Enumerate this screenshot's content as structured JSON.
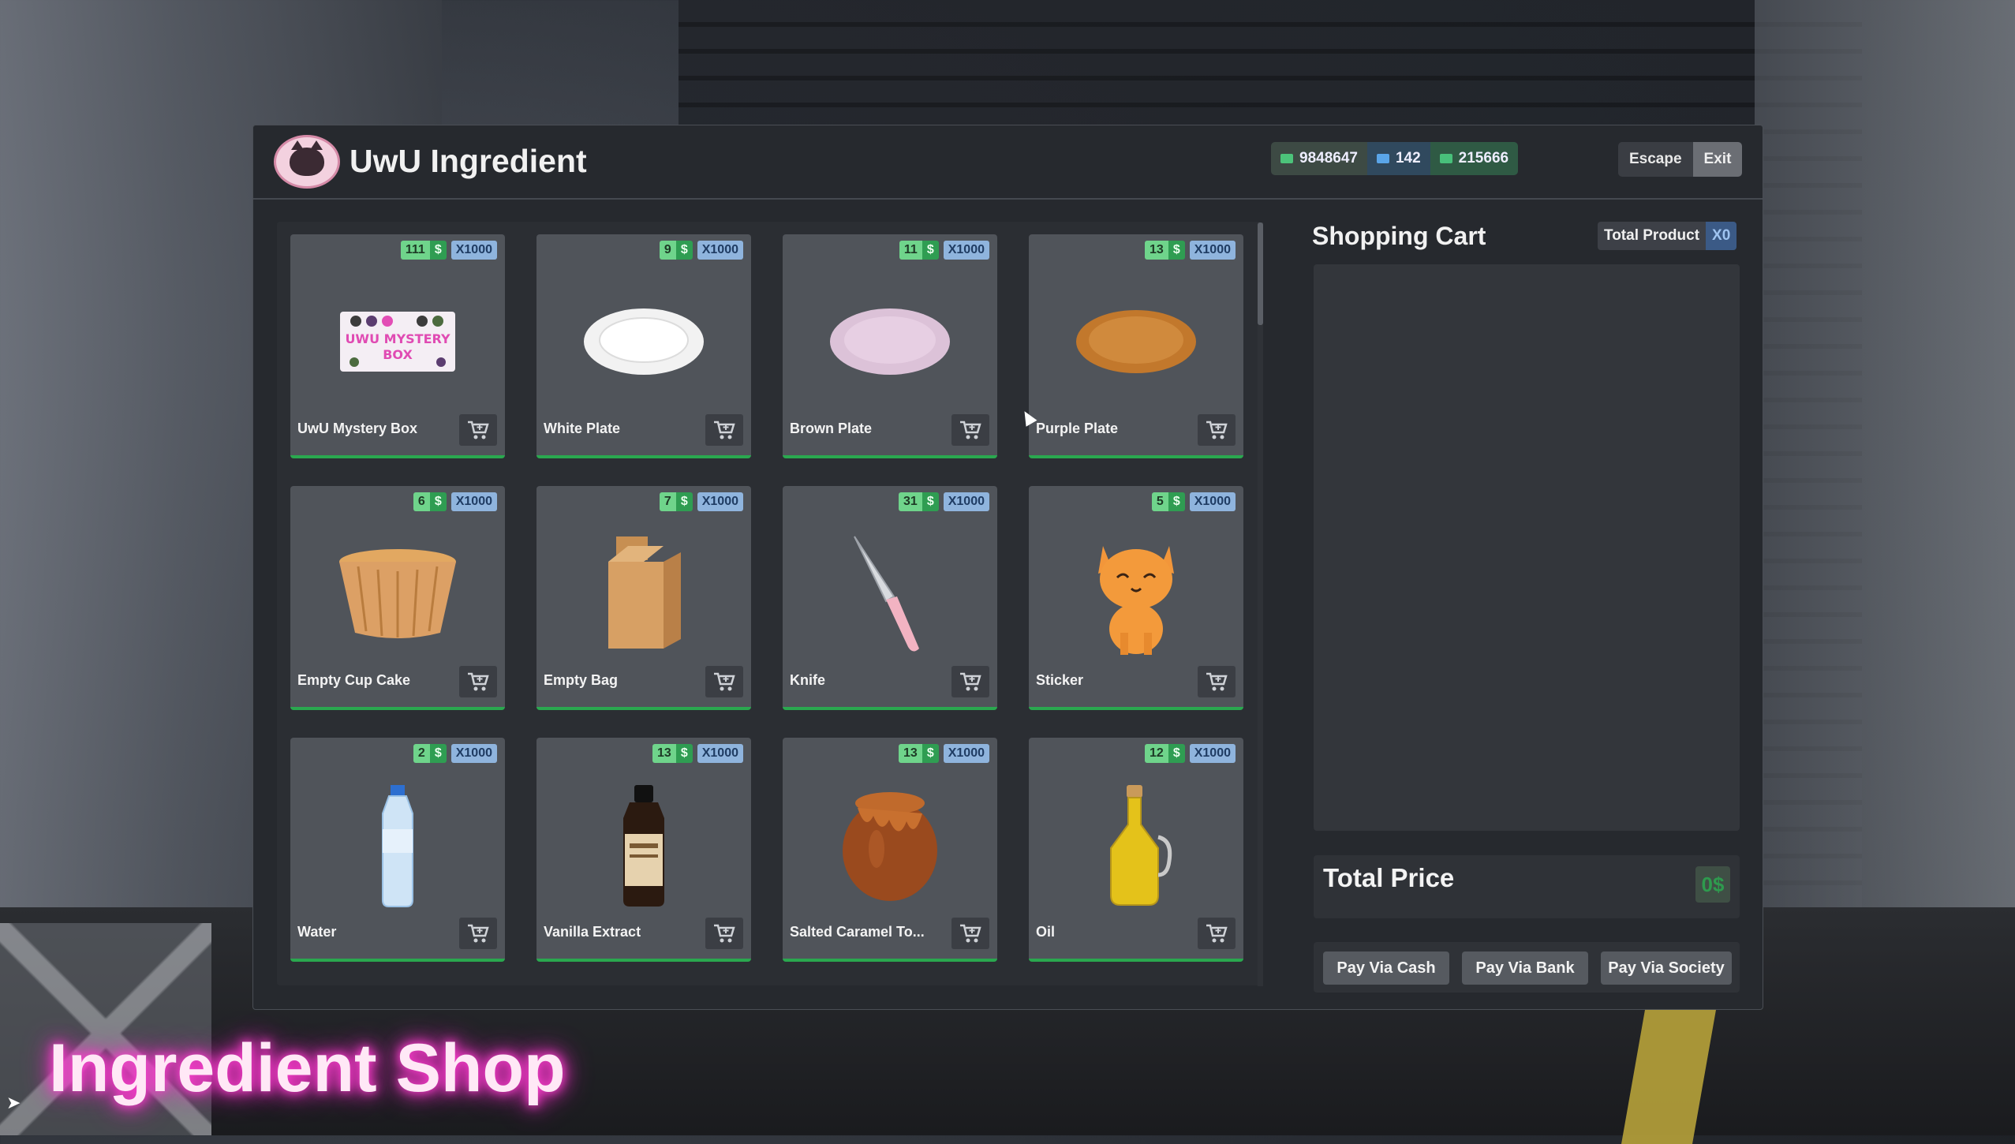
{
  "header": {
    "title": "UwU Ingredient",
    "balances": {
      "cash": "9848647",
      "bank": "142",
      "society": "215666"
    },
    "escape_label": "Escape",
    "exit_label": "Exit"
  },
  "products": [
    {
      "name": "UwU Mystery Box",
      "price": "111",
      "currency": "$",
      "qty": "X1000",
      "icon": "mystery-box-icon"
    },
    {
      "name": "White Plate",
      "price": "9",
      "currency": "$",
      "qty": "X1000",
      "icon": "white-plate-icon"
    },
    {
      "name": "Brown Plate",
      "price": "11",
      "currency": "$",
      "qty": "X1000",
      "icon": "pink-plate-icon"
    },
    {
      "name": "Purple Plate",
      "price": "13",
      "currency": "$",
      "qty": "X1000",
      "icon": "orange-plate-icon"
    },
    {
      "name": "Empty Cup Cake",
      "price": "6",
      "currency": "$",
      "qty": "X1000",
      "icon": "cupcake-liner-icon"
    },
    {
      "name": "Empty Bag",
      "price": "7",
      "currency": "$",
      "qty": "X1000",
      "icon": "paper-bag-icon"
    },
    {
      "name": "Knife",
      "price": "31",
      "currency": "$",
      "qty": "X1000",
      "icon": "knife-icon"
    },
    {
      "name": "Sticker",
      "price": "5",
      "currency": "$",
      "qty": "X1000",
      "icon": "cat-sticker-icon"
    },
    {
      "name": "Water",
      "price": "2",
      "currency": "$",
      "qty": "X1000",
      "icon": "water-bottle-icon"
    },
    {
      "name": "Vanilla Extract",
      "price": "13",
      "currency": "$",
      "qty": "X1000",
      "icon": "vanilla-bottle-icon"
    },
    {
      "name": "Salted Caramel To...",
      "price": "13",
      "currency": "$",
      "qty": "X1000",
      "icon": "caramel-jar-icon"
    },
    {
      "name": "Oil",
      "price": "12",
      "currency": "$",
      "qty": "X1000",
      "icon": "oil-bottle-icon"
    }
  ],
  "cart": {
    "title": "Shopping Cart",
    "total_product_label": "Total Product",
    "total_product_value": "X0",
    "total_price_label": "Total Price",
    "total_price_value": "0$",
    "pay_cash": "Pay Via Cash",
    "pay_bank": "Pay Via Bank",
    "pay_society": "Pay Via Society"
  },
  "overlay": {
    "shop_label": "Ingredient Shop"
  },
  "colors": {
    "accent_green": "#2aa84f",
    "price_green": "#6fd48b",
    "qty_blue": "#8fb4dd",
    "neon_pink": "#ff3fd0"
  }
}
